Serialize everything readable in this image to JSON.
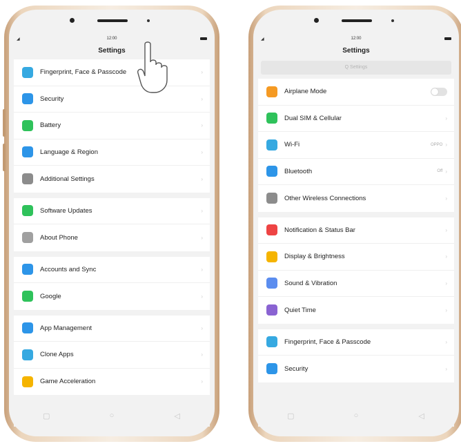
{
  "left_phone": {
    "status_time": "12:00",
    "title": "Settings",
    "groups": [
      [
        {
          "label": "Fingerprint, Face & Passcode",
          "icon": "fingerprint-icon",
          "color": "#36a9e1"
        },
        {
          "label": "Security",
          "icon": "shield-icon",
          "color": "#2d95e8"
        },
        {
          "label": "Battery",
          "icon": "battery-icon",
          "color": "#2fc25b"
        },
        {
          "label": "Language & Region",
          "icon": "language-icon",
          "color": "#2d95e8"
        },
        {
          "label": "Additional Settings",
          "icon": "additional-settings-icon",
          "color": "#8c8c8c"
        }
      ],
      [
        {
          "label": "Software Updates",
          "icon": "update-icon",
          "color": "#2fc25b"
        },
        {
          "label": "About Phone",
          "icon": "phone-info-icon",
          "color": "#a0a0a0"
        }
      ],
      [
        {
          "label": "Accounts and Sync",
          "icon": "account-icon",
          "color": "#2d95e8"
        },
        {
          "label": "Google",
          "icon": "google-icon",
          "color": "#2fc25b"
        }
      ],
      [
        {
          "label": "App Management",
          "icon": "app-management-icon",
          "color": "#2d95e8"
        },
        {
          "label": "Clone Apps",
          "icon": "clone-apps-icon",
          "color": "#36a9e1"
        },
        {
          "label": "Game Acceleration",
          "icon": "game-icon",
          "color": "#f5b400"
        }
      ]
    ]
  },
  "right_phone": {
    "status_time": "12:00",
    "title": "Settings",
    "search_placeholder": "Q Settings",
    "groups": [
      [
        {
          "label": "Airplane Mode",
          "icon": "airplane-icon",
          "color": "#f59a23",
          "toggle": true
        },
        {
          "label": "Dual SIM & Cellular",
          "icon": "sim-icon",
          "color": "#2fc25b"
        },
        {
          "label": "Wi-Fi",
          "icon": "wifi-icon",
          "color": "#36a9e1",
          "value": "OPPO"
        },
        {
          "label": "Bluetooth",
          "icon": "bluetooth-icon",
          "color": "#2d95e8",
          "value": "Off"
        },
        {
          "label": "Other Wireless Connections",
          "icon": "wireless-icon",
          "color": "#8c8c8c"
        }
      ],
      [
        {
          "label": "Notification & Status Bar",
          "icon": "notification-icon",
          "color": "#ee4444"
        },
        {
          "label": "Display & Brightness",
          "icon": "display-icon",
          "color": "#f5b400"
        },
        {
          "label": "Sound & Vibration",
          "icon": "sound-icon",
          "color": "#5b8def"
        },
        {
          "label": "Quiet Time",
          "icon": "moon-icon",
          "color": "#8a63d2"
        }
      ],
      [
        {
          "label": "Fingerprint, Face & Passcode",
          "icon": "fingerprint-icon",
          "color": "#36a9e1"
        },
        {
          "label": "Security",
          "icon": "shield-icon",
          "color": "#2d95e8"
        }
      ]
    ]
  },
  "nav": {
    "home": "home-icon",
    "back": "back-icon",
    "recent": "recent-apps-icon"
  }
}
